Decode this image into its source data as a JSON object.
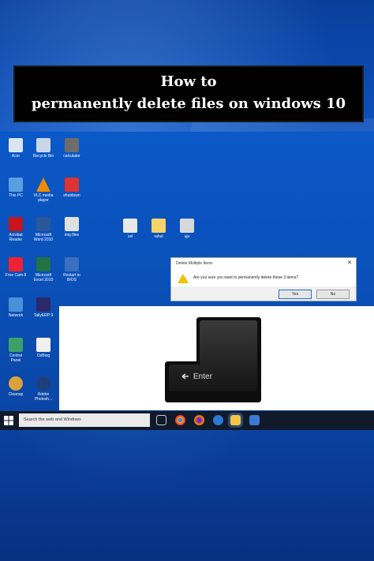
{
  "title": {
    "line1": "How to",
    "line2": "permanently delete files on windows 10"
  },
  "desktop_icons": [
    {
      "label": "Acer",
      "color": "#d9e4f5"
    },
    {
      "label": "Recycle Bin",
      "color": "#c9d6e8"
    },
    {
      "label": "calculator",
      "color": "#6d6d6d"
    },
    {
      "label": "This PC",
      "color": "#5aa0e0"
    },
    {
      "label": "VLC media\nplayer",
      "color": "#f08a00"
    },
    {
      "label": "shutdown",
      "color": "#d33"
    },
    {
      "label": "Acrobat\nReader",
      "color": "#c4161c"
    },
    {
      "label": "Microsoft\nWord 2010",
      "color": "#2b579a"
    },
    {
      "label": "img files",
      "color": "#e0e0e0"
    },
    {
      "label": "xsl",
      "color": "#e9e9e9"
    },
    {
      "label": "rahul",
      "color": "#f5d36b"
    },
    {
      "label": "uju",
      "color": "#d8d8d8"
    },
    {
      "label": "Free Cam 8",
      "color": "#e23"
    },
    {
      "label": "Microsoft\nExcel 2010",
      "color": "#217346"
    },
    {
      "label": "Restart to\nBIOS",
      "color": "#3b6fc0"
    },
    {
      "label": "Network",
      "color": "#4a90d9"
    },
    {
      "label": "TallyERP 9",
      "color": "#2a2a6a"
    },
    {
      "label": "Control\nPanel",
      "color": "#3da06a"
    },
    {
      "label": "OsBlog",
      "color": "#f0f0f0"
    },
    {
      "label": "Cleanup",
      "color": "#d9a33a"
    },
    {
      "label": "Adobe\nPhotosh...",
      "color": "#1f3f7a"
    }
  ],
  "dialog": {
    "title": "Delete Multiple Items",
    "close": "✕",
    "message": "Are you sure you want to permanently delete these 3 items?",
    "yes_label": "Yes",
    "no_label": "No"
  },
  "key": {
    "label": "Enter"
  },
  "taskbar": {
    "search_placeholder": "Search the web and Windows",
    "icons": [
      "task-view-icon",
      "chrome-icon",
      "firefox-icon",
      "edge-icon",
      "file-explorer-icon",
      "store-icon"
    ]
  }
}
